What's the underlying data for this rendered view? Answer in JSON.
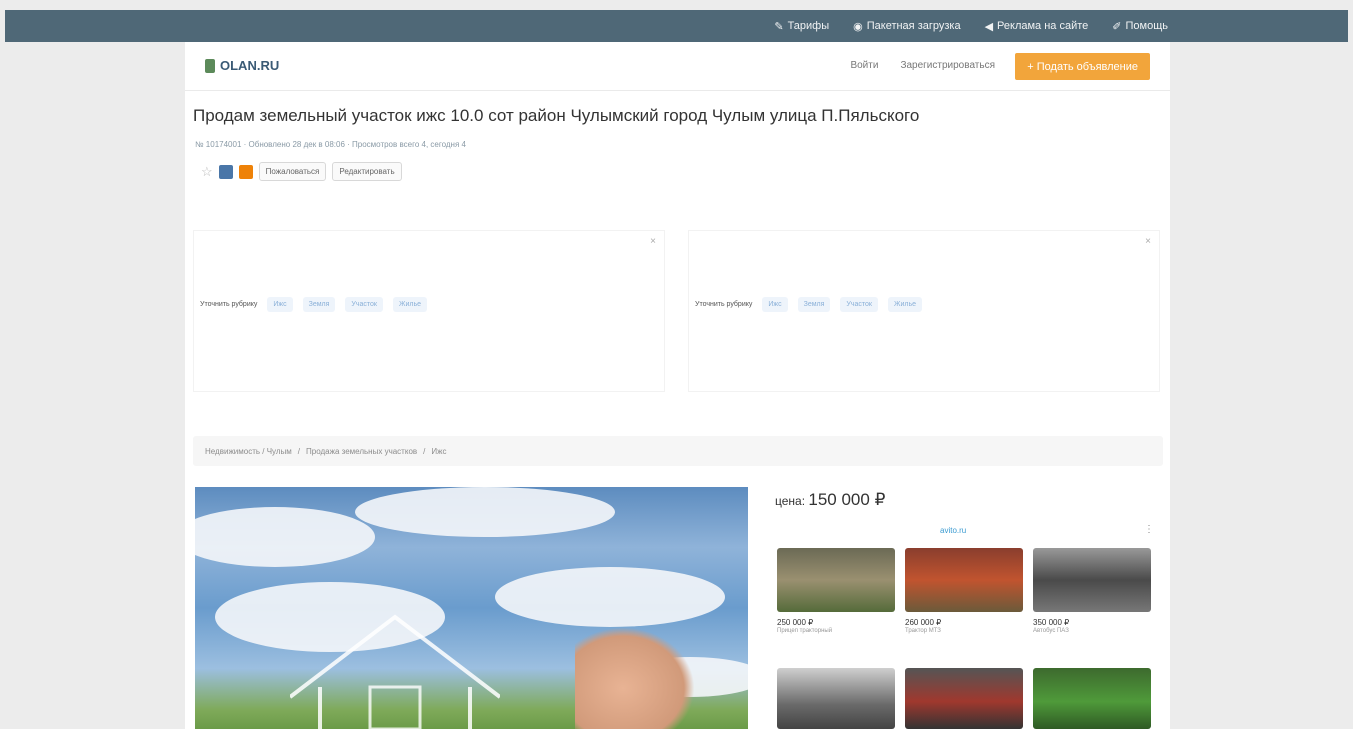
{
  "topnav": {
    "items": [
      {
        "label": "Тарифы",
        "icon": "tag-icon"
      },
      {
        "label": "Пакетная загрузка",
        "icon": "eye-icon"
      },
      {
        "label": "Реклама на сайте",
        "icon": "megaphone-icon"
      },
      {
        "label": "Помощь",
        "icon": "wrench-icon"
      }
    ]
  },
  "header": {
    "logo": "OLAN.RU",
    "login": "Войти",
    "register": "Зарегистрироваться",
    "post_button": "+ Подать объявление"
  },
  "listing": {
    "title": "Продам земельный участок ижс 10.0 сот район Чулымский город Чулым улица П.Пяльского",
    "meta": "№ 10174001 · Обновлено 28 дек в 08:06 · Просмотров всего 4, сегодня 4",
    "complain": "Пожаловаться",
    "edit": "Редактировать"
  },
  "ads": {
    "left": {
      "label": "Уточнить рубрику",
      "chips": [
        "Ижс",
        "Земля",
        "Участок",
        "Жилье"
      ]
    },
    "right": {
      "label": "Уточнить рубрику",
      "chips": [
        "Ижс",
        "Земля",
        "Участок",
        "Жилье"
      ]
    }
  },
  "breadcrumb": [
    "Недвижимость / Чулым",
    "Продажа земельных участков",
    "Ижс"
  ],
  "price": {
    "label": "цена:",
    "value": "150 000 ₽"
  },
  "adgrid": {
    "brand": "avito.ru",
    "tiles": [
      {
        "price": "250 000 ₽",
        "desc": "Прицеп тракторный"
      },
      {
        "price": "260 000 ₽",
        "desc": "Трактор МТЗ"
      },
      {
        "price": "350 000 ₽",
        "desc": "Автобус ПАЗ"
      }
    ]
  }
}
